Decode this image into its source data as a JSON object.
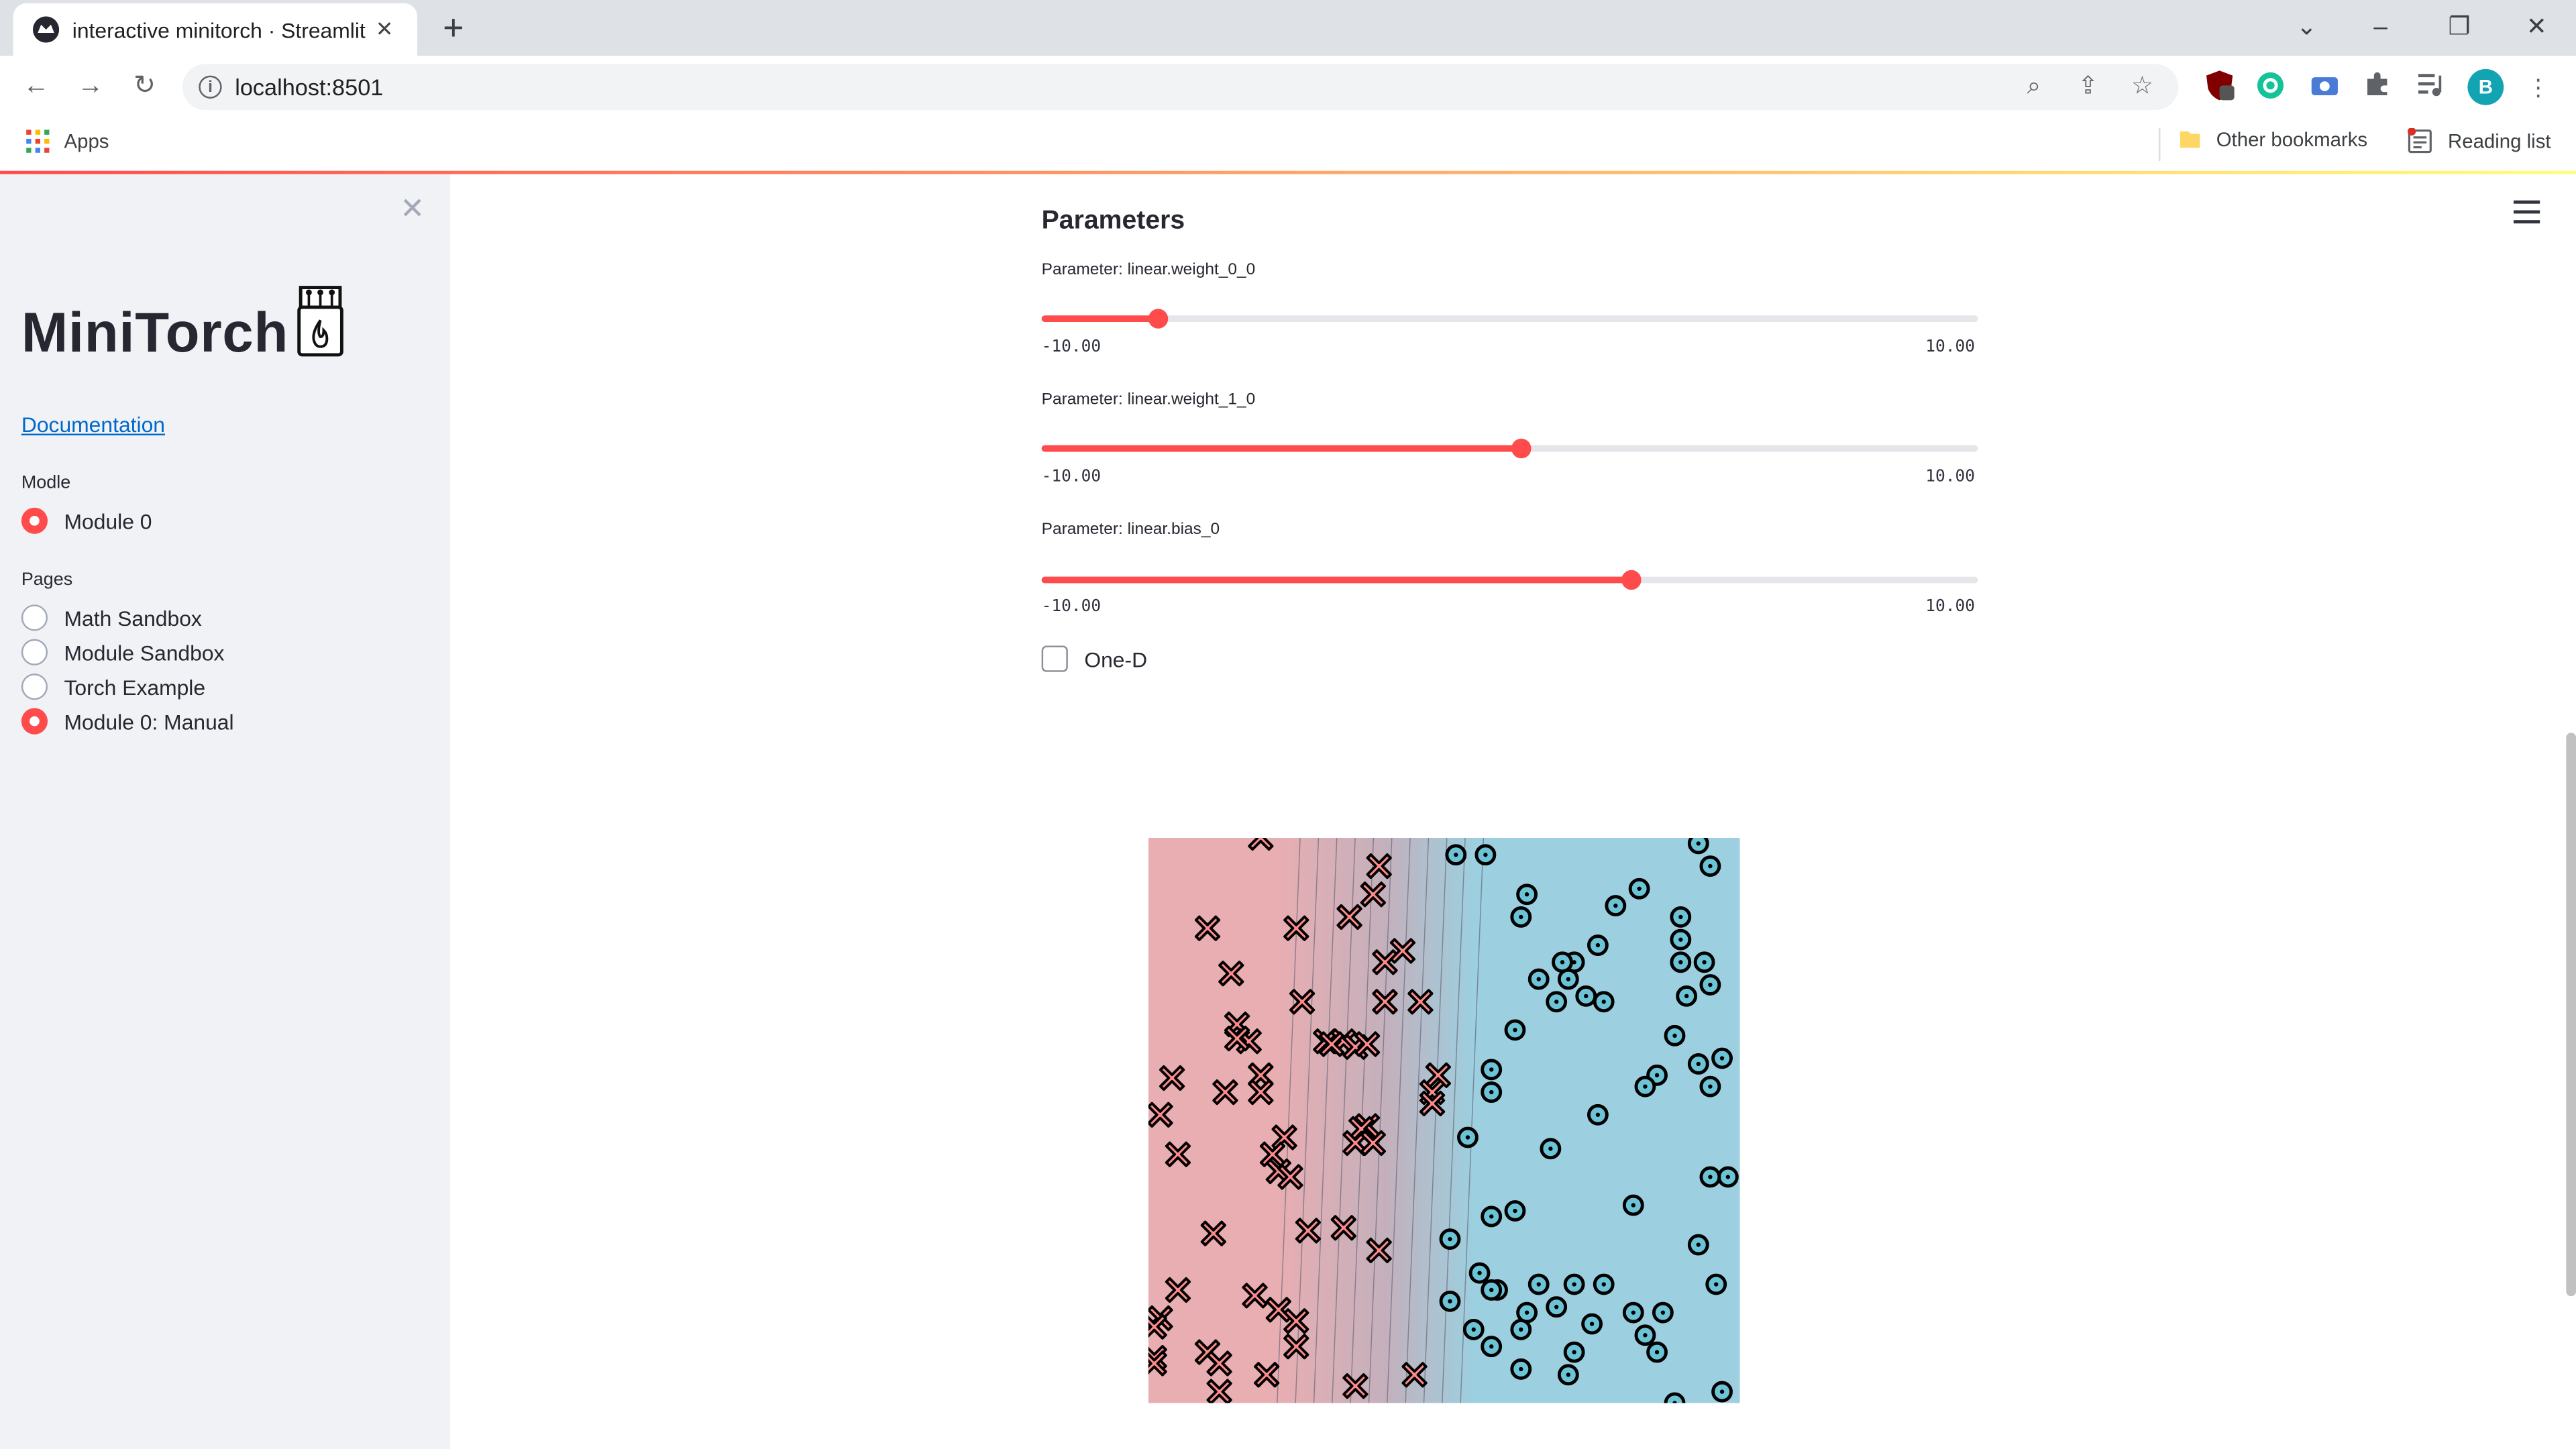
{
  "browser": {
    "tab_title": "interactive minitorch · Streamlit",
    "url": "localhost:8501",
    "profile_initial": "B",
    "bookmarks": {
      "apps": "Apps",
      "other": "Other bookmarks",
      "reading": "Reading list"
    }
  },
  "sidebar": {
    "title": "MiniTorch",
    "doc_link": "Documentation",
    "model_label": "Modle",
    "model_options": [
      {
        "label": "Module 0",
        "selected": true
      }
    ],
    "pages_label": "Pages",
    "pages": [
      {
        "label": "Math Sandbox",
        "selected": false
      },
      {
        "label": "Module Sandbox",
        "selected": false
      },
      {
        "label": "Torch Example",
        "selected": false
      },
      {
        "label": "Module 0: Manual",
        "selected": true
      }
    ]
  },
  "main": {
    "heading": "Parameters",
    "sliders": [
      {
        "label": "Parameter: linear.weight_0_0",
        "min_label": "-10.00",
        "max_label": "10.00",
        "min": -10,
        "max": 10,
        "value": -7.5
      },
      {
        "label": "Parameter: linear.weight_1_0",
        "min_label": "-10.00",
        "max_label": "10.00",
        "min": -10,
        "max": 10,
        "value": 0.25
      },
      {
        "label": "Parameter: linear.bias_0",
        "min_label": "-10.00",
        "max_label": "10.00",
        "min": -10,
        "max": 10,
        "value": 2.6
      }
    ],
    "checkbox": {
      "label": "One-D",
      "checked": false
    }
  },
  "colors": {
    "accent": "#ff4b4b",
    "class0": "#e8aeb2",
    "class1": "#9ccfdf",
    "x_marker": "#ff8a8a",
    "o_marker": "#6cc3d6"
  },
  "chart_data": {
    "type": "scatter",
    "xlim": [
      0,
      1
    ],
    "ylim": [
      0,
      1
    ],
    "decision_boundary_x": [
      0.24,
      0.55
    ],
    "series": [
      {
        "marker": "x",
        "points": [
          [
            0.19,
            1.0
          ],
          [
            0.1,
            0.84
          ],
          [
            0.25,
            0.84
          ],
          [
            0.39,
            0.95
          ],
          [
            0.38,
            0.9
          ],
          [
            0.34,
            0.86
          ],
          [
            0.4,
            0.78
          ],
          [
            0.43,
            0.8
          ],
          [
            0.14,
            0.76
          ],
          [
            0.26,
            0.71
          ],
          [
            0.4,
            0.71
          ],
          [
            0.46,
            0.71
          ],
          [
            0.15,
            0.67
          ],
          [
            0.17,
            0.64
          ],
          [
            0.15,
            0.645
          ],
          [
            0.3,
            0.64
          ],
          [
            0.33,
            0.64
          ],
          [
            0.35,
            0.63
          ],
          [
            0.31,
            0.635
          ],
          [
            0.37,
            0.635
          ],
          [
            0.04,
            0.575
          ],
          [
            0.13,
            0.55
          ],
          [
            0.19,
            0.58
          ],
          [
            0.19,
            0.55
          ],
          [
            0.49,
            0.58
          ],
          [
            0.48,
            0.55
          ],
          [
            0.48,
            0.53
          ],
          [
            0.02,
            0.51
          ],
          [
            0.23,
            0.47
          ],
          [
            0.37,
            0.49
          ],
          [
            0.36,
            0.485
          ],
          [
            0.35,
            0.46
          ],
          [
            0.38,
            0.46
          ],
          [
            0.05,
            0.44
          ],
          [
            0.21,
            0.44
          ],
          [
            0.22,
            0.41
          ],
          [
            0.24,
            0.4
          ],
          [
            0.11,
            0.3
          ],
          [
            0.27,
            0.305
          ],
          [
            0.33,
            0.31
          ],
          [
            0.39,
            0.27
          ],
          [
            0.05,
            0.2
          ],
          [
            0.18,
            0.19
          ],
          [
            0.22,
            0.165
          ],
          [
            0.25,
            0.145
          ],
          [
            0.02,
            0.15
          ],
          [
            0.01,
            0.135
          ],
          [
            0.01,
            0.08
          ],
          [
            0.1,
            0.09
          ],
          [
            0.12,
            0.07
          ],
          [
            0.25,
            0.1
          ],
          [
            0.2,
            0.05
          ],
          [
            0.35,
            0.03
          ],
          [
            0.45,
            0.05
          ],
          [
            0.12,
            0.02
          ],
          [
            0.01,
            0.07
          ]
        ]
      },
      {
        "marker": "o",
        "points": [
          [
            0.52,
            0.97
          ],
          [
            0.57,
            0.97
          ],
          [
            0.93,
            0.99
          ],
          [
            0.95,
            0.95
          ],
          [
            0.64,
            0.9
          ],
          [
            0.63,
            0.86
          ],
          [
            0.83,
            0.91
          ],
          [
            0.79,
            0.88
          ],
          [
            0.9,
            0.86
          ],
          [
            0.9,
            0.82
          ],
          [
            0.76,
            0.81
          ],
          [
            0.72,
            0.78
          ],
          [
            0.7,
            0.78
          ],
          [
            0.94,
            0.78
          ],
          [
            0.9,
            0.78
          ],
          [
            0.66,
            0.75
          ],
          [
            0.71,
            0.75
          ],
          [
            0.74,
            0.72
          ],
          [
            0.77,
            0.71
          ],
          [
            0.91,
            0.72
          ],
          [
            0.95,
            0.74
          ],
          [
            0.69,
            0.71
          ],
          [
            0.62,
            0.66
          ],
          [
            0.89,
            0.65
          ],
          [
            0.97,
            0.61
          ],
          [
            0.93,
            0.6
          ],
          [
            0.86,
            0.58
          ],
          [
            0.84,
            0.56
          ],
          [
            0.95,
            0.56
          ],
          [
            0.58,
            0.59
          ],
          [
            0.58,
            0.55
          ],
          [
            0.76,
            0.51
          ],
          [
            0.54,
            0.47
          ],
          [
            0.68,
            0.45
          ],
          [
            0.98,
            0.4
          ],
          [
            0.95,
            0.4
          ],
          [
            0.82,
            0.35
          ],
          [
            0.62,
            0.34
          ],
          [
            0.58,
            0.33
          ],
          [
            0.51,
            0.29
          ],
          [
            0.93,
            0.28
          ],
          [
            0.56,
            0.23
          ],
          [
            0.59,
            0.2
          ],
          [
            0.58,
            0.2
          ],
          [
            0.72,
            0.21
          ],
          [
            0.66,
            0.21
          ],
          [
            0.77,
            0.21
          ],
          [
            0.96,
            0.21
          ],
          [
            0.51,
            0.18
          ],
          [
            0.69,
            0.17
          ],
          [
            0.64,
            0.16
          ],
          [
            0.82,
            0.16
          ],
          [
            0.87,
            0.16
          ],
          [
            0.55,
            0.13
          ],
          [
            0.63,
            0.13
          ],
          [
            0.58,
            0.1
          ],
          [
            0.75,
            0.14
          ],
          [
            0.84,
            0.12
          ],
          [
            0.86,
            0.09
          ],
          [
            0.63,
            0.06
          ],
          [
            0.71,
            0.05
          ],
          [
            0.72,
            0.09
          ],
          [
            0.97,
            0.02
          ],
          [
            0.89,
            0.0
          ]
        ]
      }
    ]
  }
}
